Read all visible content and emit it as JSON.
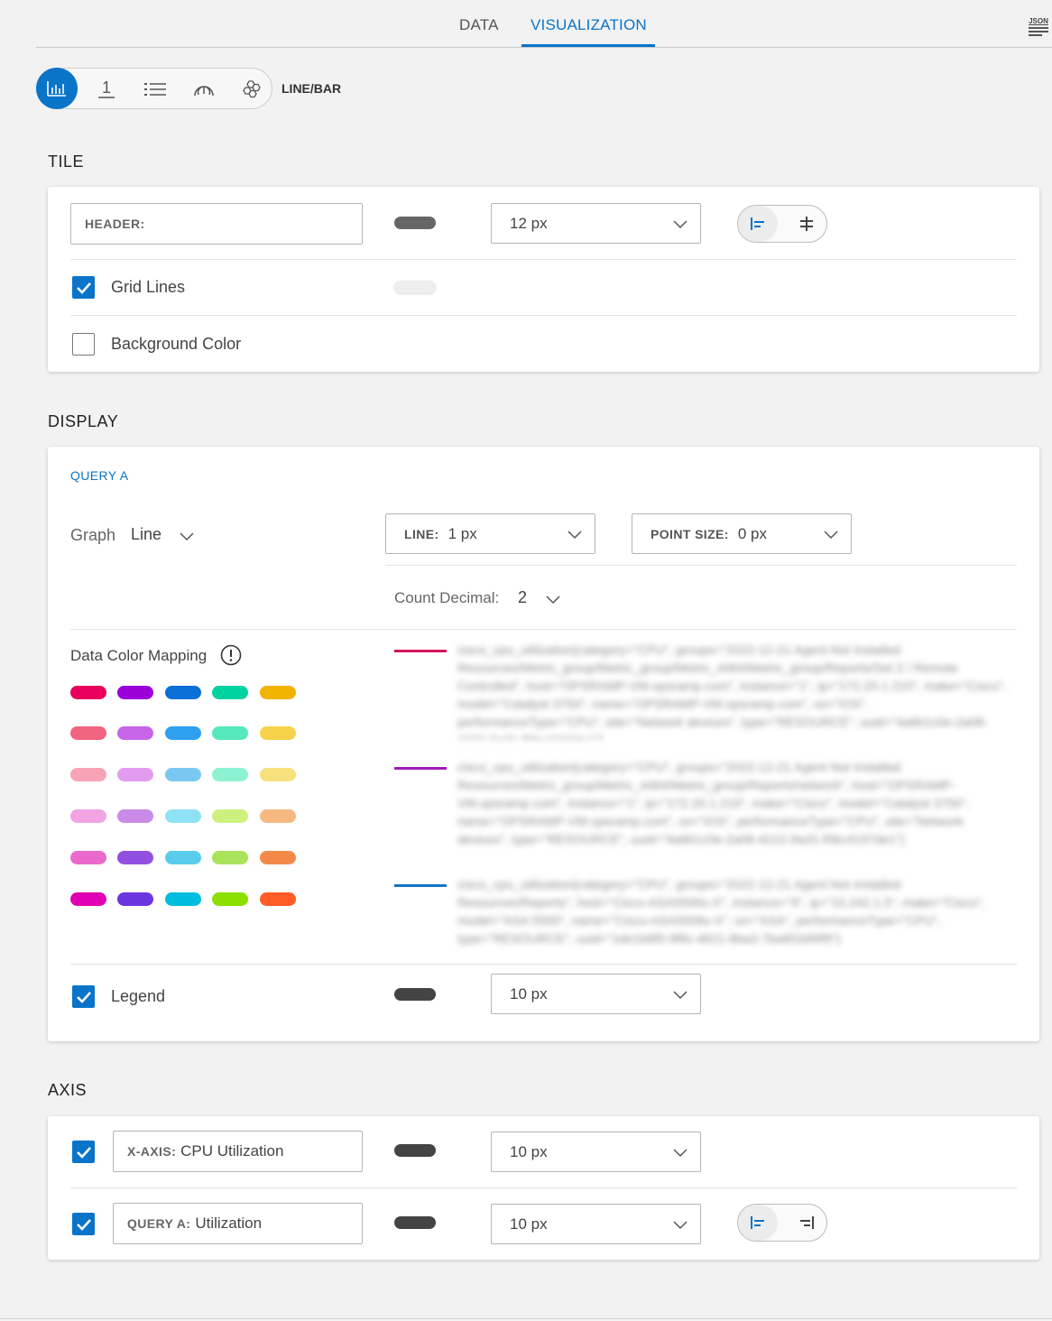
{
  "tabs": [
    {
      "label": "DATA",
      "active": false
    },
    {
      "label": "VISUALIZATION",
      "active": true
    }
  ],
  "json_button": {
    "label": "JSON",
    "icon": "json-menu-icon"
  },
  "viz_types": {
    "selected_label": "LINE/BAR",
    "items": [
      {
        "icon": "bar-chart-icon",
        "active": true
      },
      {
        "icon": "single-value-icon",
        "active": false
      },
      {
        "icon": "list-icon",
        "active": false
      },
      {
        "icon": "gauge-icon",
        "active": false
      },
      {
        "icon": "honeycomb-icon",
        "active": false
      }
    ]
  },
  "tile": {
    "section_title": "TILE",
    "header_label": "HEADER:",
    "header_value": "",
    "header_color": "#666666",
    "header_font_size": "12 px",
    "grid_lines_label": "Grid Lines",
    "grid_lines_checked": true,
    "grid_lines_color": "#eeeeee",
    "background_color_label": "Background Color",
    "background_color_checked": false
  },
  "display": {
    "section_title": "DISPLAY",
    "query_title": "QUERY A",
    "graph_label": "Graph",
    "graph_value": "Line",
    "line_label": "LINE:",
    "line_value": "1 px",
    "point_size_label": "POINT SIZE:",
    "point_size_value": "0 px",
    "count_decimal_label": "Count Decimal:",
    "count_decimal_value": "2",
    "color_mapping_label": "Data Color Mapping",
    "palette": [
      [
        "#e8005a",
        "#9b00d9",
        "#0a6fd6",
        "#00d3a0",
        "#f2b300"
      ],
      [
        "#f0647f",
        "#c765e8",
        "#2f9ff0",
        "#55e8bb",
        "#f5d24a"
      ],
      [
        "#f7a3b6",
        "#e39bf0",
        "#7ac8f2",
        "#8df2d2",
        "#f6e17e"
      ],
      [
        "#f2a3e2",
        "#c98ae8",
        "#8ee2f3",
        "#cdf17f",
        "#f6b881"
      ],
      [
        "#ea6acc",
        "#9250e0",
        "#58ccea",
        "#a9e35c",
        "#f38a4a"
      ],
      [
        "#e000b3",
        "#6a35e0",
        "#00bde0",
        "#8ce000",
        "#ff5c26"
      ]
    ],
    "series": [
      {
        "color": "#d6145f",
        "text": "cisco_cpu_utilization{category=\"CPU\", groups=\"2022-12-21 Agent Not Installed Resources/Metric_group/Metric_group/Metric_4464/Metric_group/Reports/Set 2 / Remote Controlled\", host=\"OPSRAMP-VM.opsramp.com\", instance=\"1\", ip=\"172.20.1.210\", make=\"Cisco\", model=\"Catalyst 3750\", name=\"OPSRAMP-VM.opsramp.com\", os=\"IOS\", performanceType=\"CPU\", site=\"Network devices\", type=\"RESOURCE\", uuid=\"4a6b1c0e-2a08-4222-9a31-f0bc4197de1\"}"
      },
      {
        "color": "#a11bb8",
        "text": "cisco_cpu_utilization{category=\"CPU\", groups=\"2022-12-21 Agent Not Installed Resources/Metric_group/Metric_4464/Metric_group/Reports/network\", host=\"OPSRAMP-VM.opsramp.com\", instance=\"1\", ip=\"172.20.1.210\", make=\"Cisco\", model=\"Catalyst 3750\", name=\"OPSRAMP-VM.opsramp.com\", os=\"IOS\", performanceType=\"CPU\", site=\"Network devices\", type=\"RESOURCE\", uuid=\"4a6b1c0e-2a08-4222-9a31-f0bc4197de1\"}"
      },
      {
        "color": "#0a74c9",
        "text": "cisco_cpu_utilization{category=\"CPU\", groups=\"2022-12-21 Agent Not Installed Resources/Reports\", host=\"Cisco-ASA5506x-X\", instance=\"9\", ip=\"10.242.1.5\", make=\"Cisco\", model=\"ASA 5500\", name=\"Cisco-ASA5506x-X\", os=\"ASA\", performanceType=\"CPU\", type=\"RESOURCE\", uuid=\"1de1b6f0-9f8c-4621-8ba3-7ba6f1b89f9\"}"
      }
    ],
    "legend_label": "Legend",
    "legend_checked": true,
    "legend_color": "#444444",
    "legend_font_size": "10 px"
  },
  "axis": {
    "section_title": "AXIS",
    "x_axis_label": "X-AXIS:",
    "x_axis_value": "CPU Utilization",
    "x_axis_checked": true,
    "x_axis_color": "#444444",
    "x_axis_font_size": "10 px",
    "y_axis_label": "QUERY A:",
    "y_axis_value": "Utilization",
    "y_axis_checked": true,
    "y_axis_color": "#444444",
    "y_axis_font_size": "10 px"
  }
}
